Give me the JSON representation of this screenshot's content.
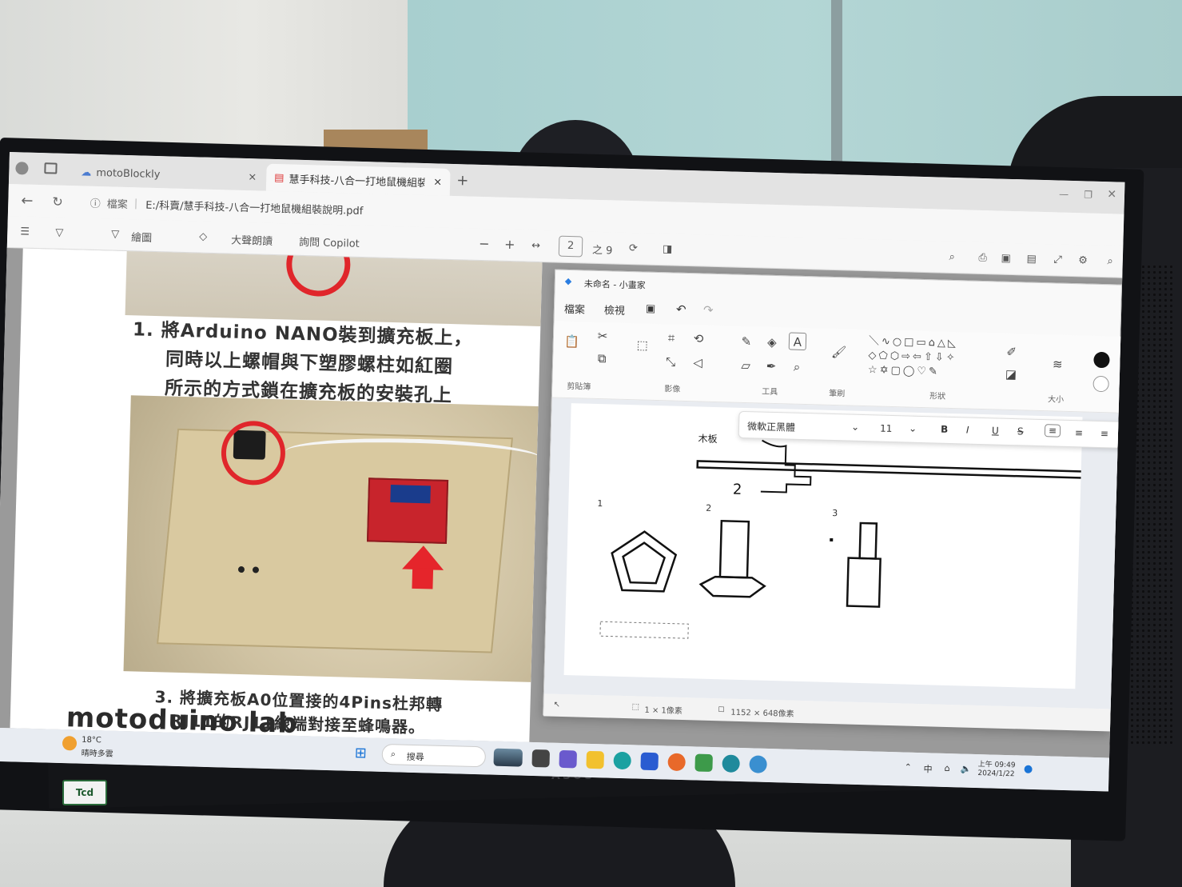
{
  "browser": {
    "tabs": [
      {
        "label": "motoBlockly"
      },
      {
        "label": "慧手科技-八合一打地鼠機組裝說"
      }
    ],
    "address": {
      "scheme_label": "檔案",
      "path": "E:/科賣/慧手科技-八合一打地鼠機組裝說明.pdf"
    },
    "pdf_toolbar": {
      "draw_label": "繪圖",
      "read_aloud_label": "大聲朗讀",
      "copilot_label": "詢問 Copilot",
      "page_current": "2",
      "page_total": "之 9"
    }
  },
  "pdf": {
    "step1_line1": "1. 將Arduino NANO裝到擴充板上，",
    "step1_line2": "同時以上螺帽與下塑膠螺柱如紅圈",
    "step1_line3": "所示的方式鎖在擴充板的安裝孔上",
    "step3_line1": "3. 將擴充板A0位置接的4Pins杜邦轉",
    "step3_line2": "RJ11的RJ11線端對接至蜂鳴器。",
    "logo": "motoduino lab"
  },
  "paint": {
    "title": "未命名 - 小畫家",
    "menu": {
      "file": "檔案",
      "view": "檢視"
    },
    "groups": {
      "clipboard": "剪貼簿",
      "image": "影像",
      "tools": "工具",
      "brush": "筆刷",
      "shapes": "形狀",
      "size": "大小"
    },
    "textbar": {
      "font": "微軟正黑體",
      "size": "11"
    },
    "canvas_text": {
      "wood": "木板",
      "n1": "1",
      "n2": "2",
      "n3": "3",
      "hand2": "2"
    },
    "status": {
      "selection": "1 × 1像素",
      "canvas_size": "1152 × 648像素"
    }
  },
  "taskbar": {
    "weather_temp": "18°C",
    "weather_desc": "晴時多雲",
    "search_label": "搜尋",
    "ime": "中",
    "time": "上午 09:49",
    "date": "2024/1/22"
  },
  "monitor": {
    "brand": "ASUS",
    "sticker": "Tcd"
  }
}
